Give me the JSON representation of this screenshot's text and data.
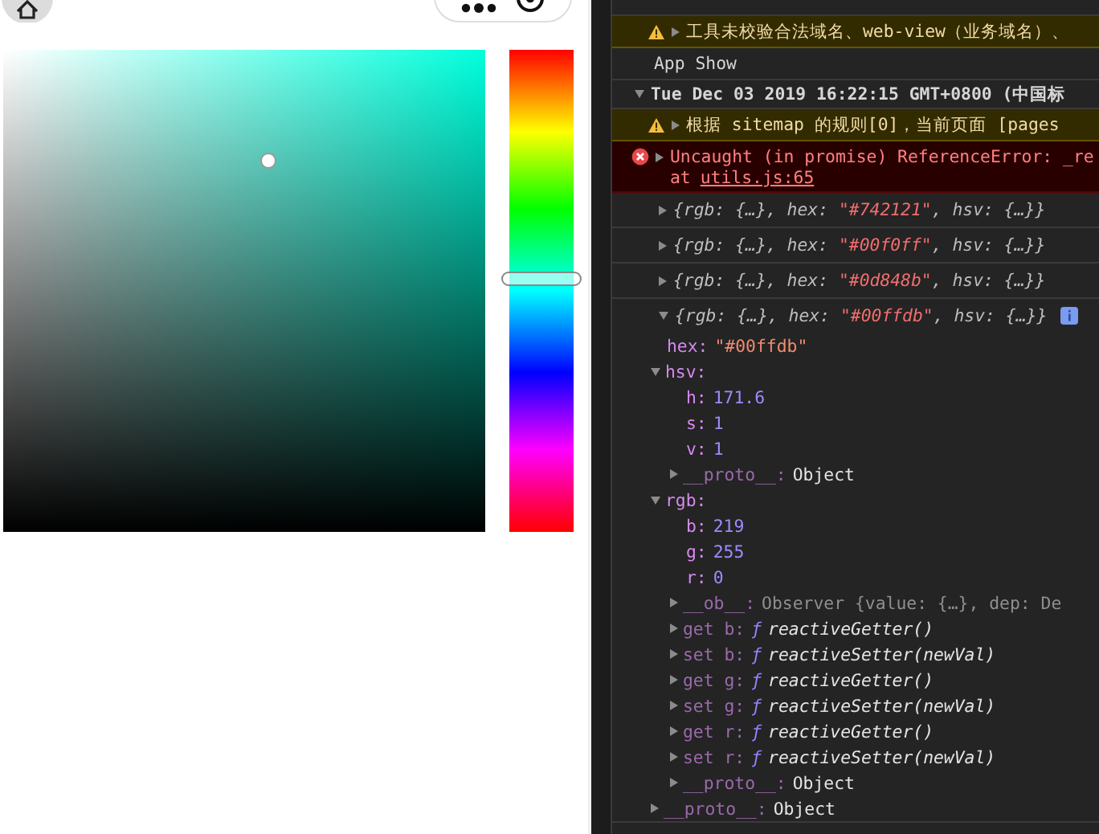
{
  "color_picker": {
    "hue_slider": {
      "level": 0.477
    }
  },
  "console": {
    "messages": [
      {
        "kind": "warning",
        "expanded": false,
        "text": "工具未校验合法域名、web-view（业务域名）、"
      },
      {
        "kind": "log",
        "text": "App Show"
      },
      {
        "kind": "group",
        "expanded": true,
        "text": "Tue Dec 03 2019 16:22:15 GMT+0800 (中国标",
        "children": [
          {
            "kind": "warning",
            "expanded": false,
            "text": "根据 sitemap 的规则[0]，当前页面 [pages"
          },
          {
            "kind": "error",
            "expanded": false,
            "text": "Uncaught (in promise) ReferenceError: _re",
            "location_prefix": "at",
            "location": "utils.js:65"
          },
          {
            "kind": "object",
            "expanded": false,
            "preview": [
              {
                "text": "{rgb: {…}, hex: ",
                "kind": "plain"
              },
              {
                "text": "\"#742121\"",
                "kind": "string"
              },
              {
                "text": ", hsv: {…}}",
                "kind": "plain"
              }
            ]
          },
          {
            "kind": "object",
            "expanded": false,
            "preview": [
              {
                "text": "{rgb: {…}, hex: ",
                "kind": "plain"
              },
              {
                "text": "\"#00f0ff\"",
                "kind": "string"
              },
              {
                "text": ", hsv: {…}}",
                "kind": "plain"
              }
            ]
          },
          {
            "kind": "object",
            "expanded": false,
            "preview": [
              {
                "text": "{rgb: {…}, hex: ",
                "kind": "plain"
              },
              {
                "text": "\"#0d848b\"",
                "kind": "string"
              },
              {
                "text": ", hsv: {…}}",
                "kind": "plain"
              }
            ]
          },
          {
            "kind": "object",
            "expanded": true,
            "info_badge": true,
            "preview": [
              {
                "text": "{rgb: {…}, hex: ",
                "kind": "plain"
              },
              {
                "text": "\"#00ffdb\"",
                "kind": "string"
              },
              {
                "text": ", hsv: {…}}",
                "kind": "plain"
              }
            ],
            "children": [
              {
                "key": "hex:",
                "dimmed": false,
                "value": "\"#00ffdb\"",
                "kind": "string"
              },
              {
                "key": "hsv:",
                "dimmed": false,
                "expanded": true,
                "children": [
                  {
                    "key": "h:",
                    "dimmed": false,
                    "value": "171.6",
                    "kind": "number"
                  },
                  {
                    "key": "s:",
                    "dimmed": false,
                    "value": "1",
                    "kind": "number"
                  },
                  {
                    "key": "v:",
                    "dimmed": false,
                    "value": "1",
                    "kind": "number"
                  },
                  {
                    "key": "__proto__:",
                    "dimmed": true,
                    "expanded": false,
                    "value": "Object",
                    "kind": "plain"
                  }
                ]
              },
              {
                "key": "rgb:",
                "dimmed": false,
                "expanded": true,
                "children": [
                  {
                    "key": "b:",
                    "dimmed": false,
                    "value": "219",
                    "kind": "number"
                  },
                  {
                    "key": "g:",
                    "dimmed": false,
                    "value": "255",
                    "kind": "number"
                  },
                  {
                    "key": "r:",
                    "dimmed": false,
                    "value": "0",
                    "kind": "number"
                  },
                  {
                    "key": "__ob__:",
                    "dimmed": true,
                    "expanded": false,
                    "value": "Observer {value: {…}, dep: De",
                    "kind": "observer"
                  },
                  {
                    "key": "get b:",
                    "dimmed": true,
                    "expanded": false,
                    "glyph": "ƒ",
                    "value": "reactiveGetter()",
                    "kind": "function"
                  },
                  {
                    "key": "set b:",
                    "dimmed": true,
                    "expanded": false,
                    "glyph": "ƒ",
                    "value": "reactiveSetter(newVal)",
                    "kind": "function"
                  },
                  {
                    "key": "get g:",
                    "dimmed": true,
                    "expanded": false,
                    "glyph": "ƒ",
                    "value": "reactiveGetter()",
                    "kind": "function"
                  },
                  {
                    "key": "set g:",
                    "dimmed": true,
                    "expanded": false,
                    "glyph": "ƒ",
                    "value": "reactiveSetter(newVal)",
                    "kind": "function"
                  },
                  {
                    "key": "get r:",
                    "dimmed": true,
                    "expanded": false,
                    "glyph": "ƒ",
                    "value": "reactiveGetter()",
                    "kind": "function"
                  },
                  {
                    "key": "set r:",
                    "dimmed": true,
                    "expanded": false,
                    "glyph": "ƒ",
                    "value": "reactiveSetter(newVal)",
                    "kind": "function"
                  },
                  {
                    "key": "__proto__:",
                    "dimmed": true,
                    "expanded": false,
                    "value": "Object",
                    "kind": "plain"
                  }
                ]
              },
              {
                "key": "__proto__:",
                "dimmed": true,
                "expanded": false,
                "value": "Object",
                "kind": "plain"
              }
            ]
          }
        ]
      }
    ]
  }
}
